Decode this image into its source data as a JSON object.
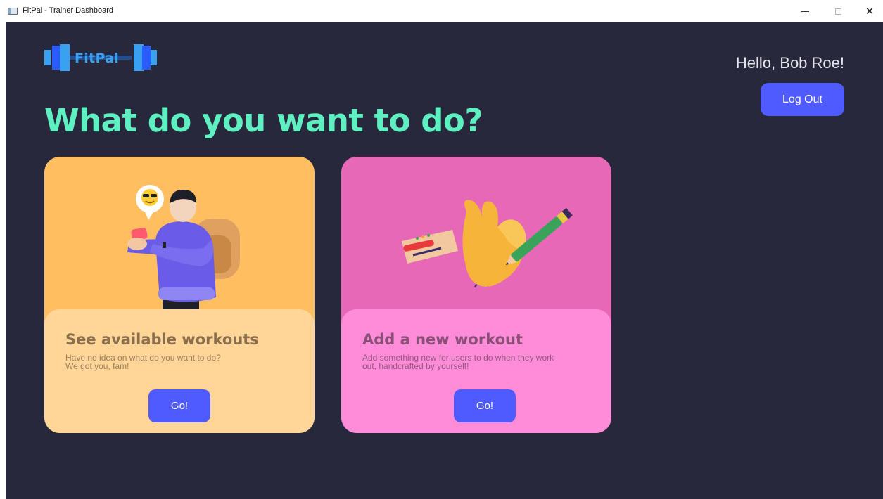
{
  "window": {
    "title": "FitPal - Trainer Dashboard",
    "close_glyph": "✕"
  },
  "header": {
    "logo_text": "FitPal",
    "greeting": "Hello, Bob Roe!",
    "logout_label": "Log Out"
  },
  "main": {
    "headline": "What do you want to do?",
    "cards": [
      {
        "title": "See available workouts",
        "description": "Have no idea on what do you want to do?\nWe got you, fam!",
        "button_label": "Go!",
        "illustration": "person-with-phone-and-backpack"
      },
      {
        "title": "Add a new workout",
        "description": "Add something new for users to do when they work\nout, handcrafted by yourself!",
        "button_label": "Go!",
        "illustration": "hand-holding-pencil"
      }
    ]
  },
  "colors": {
    "background": "#28283d",
    "accent": "#5ef0c0",
    "button": "#4f5bff",
    "card_left": "#ffbe60",
    "card_left_body": "#ffd698",
    "card_right": "#e868b8",
    "card_right_body": "#ff8cd8"
  }
}
